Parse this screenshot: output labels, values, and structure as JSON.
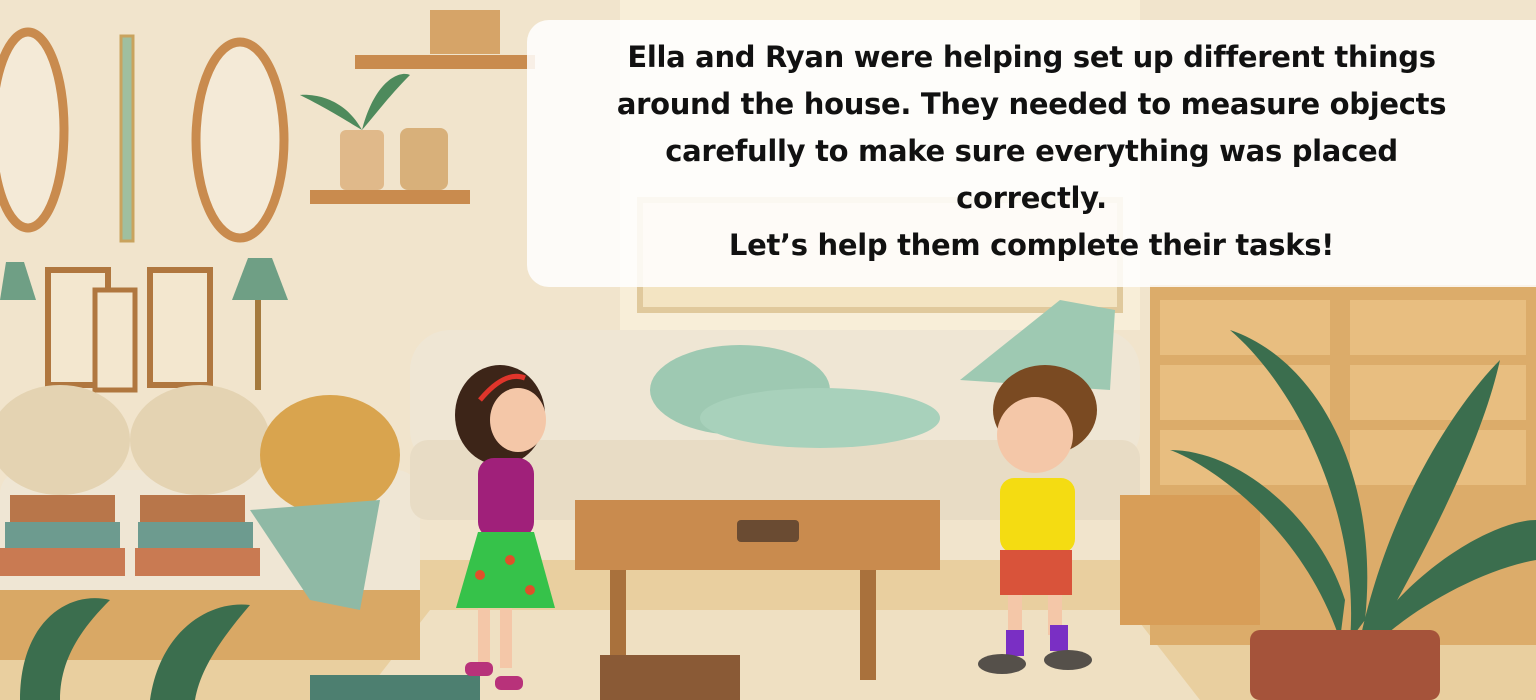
{
  "story": {
    "lines": [
      "Ella and Ryan were helping set up different things",
      "around the house. They needed to measure objects",
      "carefully to make sure everything was placed",
      "correctly.",
      "Let’s help them complete their tasks!"
    ]
  },
  "colors": {
    "wall": "#f1e4cc",
    "floor": "#e9cf9f",
    "sofa": "#efe6d4",
    "pillow": "#9ec9b2",
    "wood": "#c98b4e",
    "drawer": "#dcac6a",
    "leaf": "#3b6e4e",
    "pot": "#a5533a",
    "ella_top": "#a0207a",
    "ella_skirt": "#36c24a",
    "ryan_shirt": "#f4dc12",
    "ryan_shorts": "#d9533a",
    "socks": "#7a2fc4"
  },
  "icons": {
    "mirror": "oval-mirror-icon",
    "plant": "potted-plant-icon",
    "lamp": "table-lamp-icon"
  }
}
